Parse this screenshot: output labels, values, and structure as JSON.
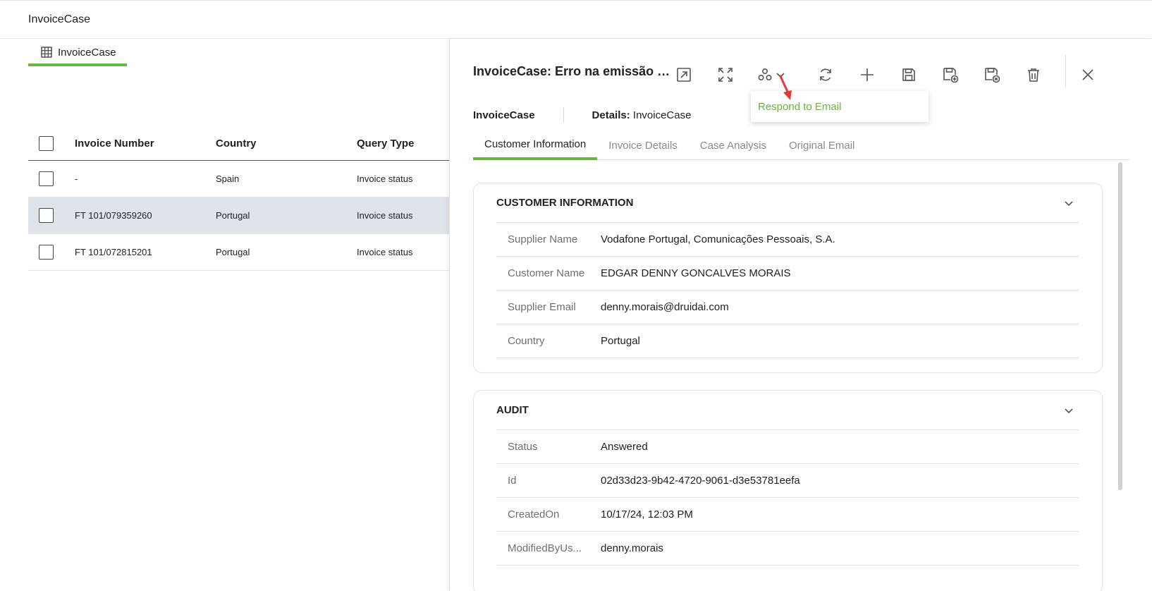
{
  "app": {
    "title": "InvoiceCase"
  },
  "list": {
    "tab_label": "InvoiceCase",
    "columns": [
      "Invoice Number",
      "Country",
      "Query Type"
    ],
    "rows": [
      {
        "invoice_number": "-",
        "country": "Spain",
        "query_type": "Invoice status",
        "selected": false
      },
      {
        "invoice_number": "FT 101/079359260",
        "country": "Portugal",
        "query_type": "Invoice status",
        "selected": true
      },
      {
        "invoice_number": "FT 101/072815201",
        "country": "Portugal",
        "query_type": "Invoice status",
        "selected": false
      }
    ]
  },
  "detail": {
    "title": "InvoiceCase: Erro na emissão de...",
    "toolbar": {
      "icons": [
        "open-external-icon",
        "expand-icon",
        "actions-icon",
        "refresh-icon",
        "add-icon",
        "save-icon",
        "save-new-icon",
        "save-close-icon",
        "delete-icon",
        "close-icon"
      ]
    },
    "actions_menu": {
      "items": [
        "Respond to Email"
      ]
    },
    "breadcrumb": {
      "first": "InvoiceCase",
      "second_prefix": "Details:",
      "second_value": "InvoiceCase"
    },
    "tabs": [
      "Customer Information",
      "Invoice Details",
      "Case Analysis",
      "Original Email"
    ],
    "active_tab": "Customer Information",
    "sections": {
      "customer": {
        "title": "CUSTOMER INFORMATION",
        "fields": [
          {
            "label": "Supplier Name",
            "value": "Vodafone Portugal, Comunicações Pessoais, S.A."
          },
          {
            "label": "Customer Name",
            "value": "EDGAR DENNY GONCALVES MORAIS"
          },
          {
            "label": "Supplier Email",
            "value": "denny.morais@druidai.com"
          },
          {
            "label": "Country",
            "value": "Portugal"
          }
        ]
      },
      "audit": {
        "title": "AUDIT",
        "fields": [
          {
            "label": "Status",
            "value": "Answered"
          },
          {
            "label": "Id",
            "value": "02d33d23-9b42-4720-9061-d3e53781eefa"
          },
          {
            "label": "CreatedOn",
            "value": "10/17/24, 12:03 PM"
          },
          {
            "label": "ModifiedByUs...",
            "value": "denny.morais"
          }
        ]
      }
    }
  },
  "colors": {
    "accent": "#6db33f",
    "selected_row": "#dfe3ea",
    "annotation_arrow": "#e53935"
  }
}
